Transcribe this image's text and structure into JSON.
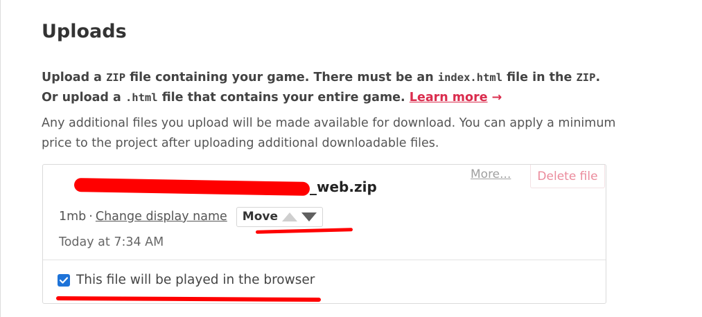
{
  "section": {
    "title": "Uploads",
    "lead": {
      "part1": "Upload a ",
      "code_zip_1": "ZIP",
      "part2": " file containing your game. There must be an ",
      "code_index": "index.html",
      "part3": " file in the ",
      "code_zip_2": "ZIP",
      "part4": ".",
      "part5": "Or upload a ",
      "code_html": ".html",
      "part6": " file that contains your entire game. ",
      "learn_more": "Learn more",
      "arrow": "→"
    },
    "note": "Any additional files you upload will be made available for download. You can apply a minimum price to the project after uploading additional downloadable files."
  },
  "upload": {
    "filename_visible": "_web.zip",
    "size": "1mb",
    "separator": "·",
    "change_name_label": "Change display name",
    "move_label": "Move",
    "uploaded_at": "Today at 7:34 AM",
    "more_label": "More...",
    "delete_label": "Delete file",
    "browser_checkbox_label": "This file will be played in the browser",
    "browser_checkbox_checked": true
  },
  "colors": {
    "accent": "#da2c4d",
    "checkbox": "#1e73d8",
    "annotation": "#ff0000"
  }
}
